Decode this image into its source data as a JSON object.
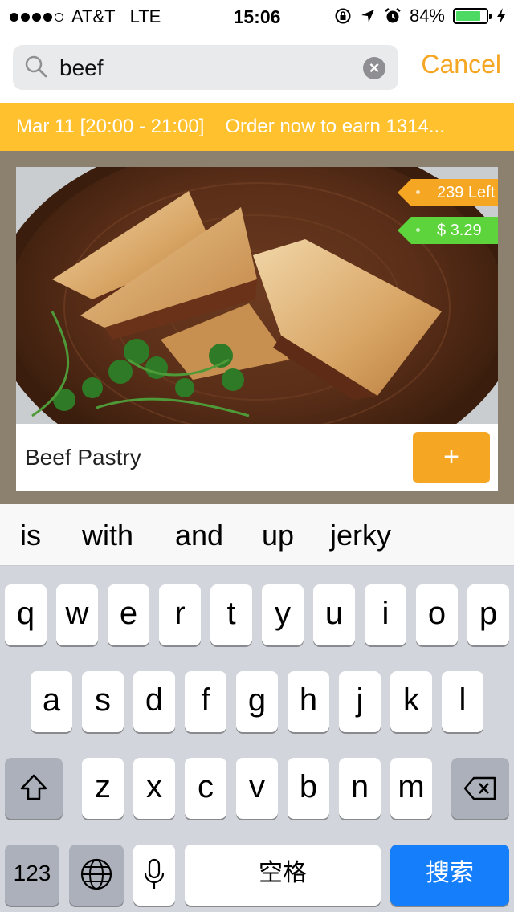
{
  "status_bar": {
    "carrier": "AT&T",
    "network": "LTE",
    "time": "15:06",
    "battery": "84%",
    "battery_fraction": 0.84,
    "battery_color": "#4cd964"
  },
  "search": {
    "query": "beef",
    "cancel_label": "Cancel"
  },
  "banner": {
    "slot": "Mar 11 [20:00 - 21:00]",
    "promo": "Order now to earn 1314..."
  },
  "item": {
    "name": "Beef Pastry",
    "stock": "239 Left",
    "price": "$ 3.29",
    "add_label": "+"
  },
  "suggestions": [
    "is",
    "with",
    "and",
    "up",
    "jerky"
  ],
  "keyboard": {
    "row1": [
      "q",
      "w",
      "e",
      "r",
      "t",
      "y",
      "u",
      "i",
      "o",
      "p"
    ],
    "row2": [
      "a",
      "s",
      "d",
      "f",
      "g",
      "h",
      "j",
      "k",
      "l"
    ],
    "row3": [
      "z",
      "x",
      "c",
      "v",
      "b",
      "n",
      "m"
    ],
    "numbers_label": "123",
    "space_label": "空格",
    "search_label": "搜索"
  },
  "colors": {
    "accent": "#f5a623",
    "banner": "#ffc12e",
    "price_tag": "#5dd33c",
    "search_key": "#147efb"
  }
}
